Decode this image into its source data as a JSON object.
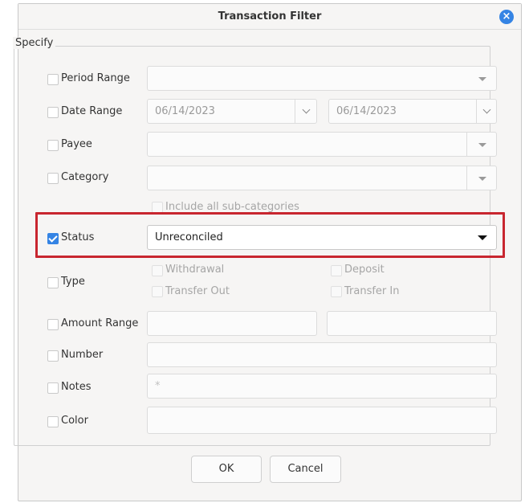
{
  "window": {
    "title": "Transaction Filter"
  },
  "group": {
    "label": "Specify"
  },
  "period_range": {
    "label": "Period Range",
    "value": ""
  },
  "date_range": {
    "label": "Date Range",
    "from": "06/14/2023",
    "to": "06/14/2023"
  },
  "payee": {
    "label": "Payee",
    "value": ""
  },
  "category": {
    "label": "Category",
    "value": "",
    "sub_label": "Include all sub-categories"
  },
  "status": {
    "label": "Status",
    "value": "Unreconciled",
    "checked": true
  },
  "type": {
    "label": "Type",
    "options": [
      "Withdrawal",
      "Deposit",
      "Transfer Out",
      "Transfer In"
    ]
  },
  "amount_range": {
    "label": "Amount Range",
    "min": "",
    "max": ""
  },
  "number": {
    "label": "Number",
    "value": ""
  },
  "notes": {
    "label": "Notes",
    "value": "*"
  },
  "color": {
    "label": "Color"
  },
  "buttons": {
    "ok": "OK",
    "cancel": "Cancel"
  },
  "colors": {
    "accent": "#3584e4",
    "highlight": "#c8262f"
  }
}
